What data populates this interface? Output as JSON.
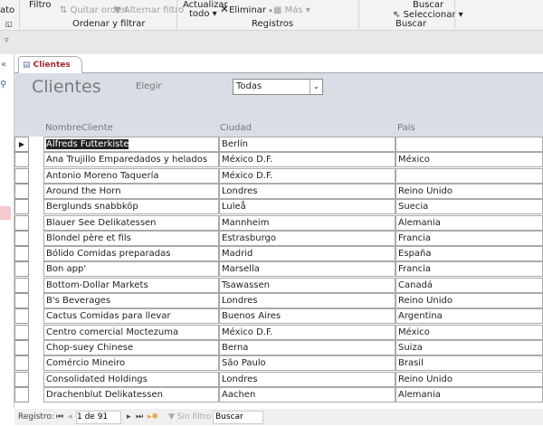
{
  "ribbon": {
    "filtro": "Filtro",
    "quitar_orden": "Quitar orden",
    "alternar_filtro": "Alternar filtro",
    "actualizar": "Actualizar",
    "todo": "todo ▾",
    "eliminar": "Eliminar",
    "mas": "Más ▾",
    "buscar_btn": "Buscar",
    "seleccionar": "Seleccionar ▾",
    "group_ordenar": "Ordenar y filtrar",
    "group_registros": "Registros",
    "group_buscar": "Buscar",
    "ato": "ato"
  },
  "tab": {
    "label": "Clientes"
  },
  "form": {
    "title": "Clientes",
    "elegir_label": "Elegir",
    "elegir_value": "Todas"
  },
  "columns": [
    "NombreCliente",
    "Ciudad",
    "Pais"
  ],
  "rows": [
    [
      "Alfreds Futterkiste",
      "Berlín",
      ""
    ],
    [
      "Ana Trujillo Emparedados y helados",
      "México D.F.",
      "México"
    ],
    [
      "Antonio Moreno Taquería",
      "México D.F.",
      ""
    ],
    [
      "Around the Horn",
      "Londres",
      "Reino Unido"
    ],
    [
      "Berglunds snabbköp",
      "Luleå",
      "Suecia"
    ],
    [
      "Blauer See Delikatessen",
      "Mannheim",
      "Alemania"
    ],
    [
      "Blondel père et fils",
      "Estrasburgo",
      "Francia"
    ],
    [
      "Bólido Comidas preparadas",
      "Madrid",
      "España"
    ],
    [
      "Bon app'",
      "Marsella",
      "Francia"
    ],
    [
      "Bottom-Dollar Markets",
      "Tsawassen",
      "Canadá"
    ],
    [
      "B's Beverages",
      "Londres",
      "Reino Unido"
    ],
    [
      "Cactus Comidas para llevar",
      "Buenos Aires",
      "Argentina"
    ],
    [
      "Centro comercial Moctezuma",
      "México D.F.",
      "México"
    ],
    [
      "Chop-suey Chinese",
      "Berna",
      "Suiza"
    ],
    [
      "Comércio Mineiro",
      "São Paulo",
      "Brasil"
    ],
    [
      "Consolidated Holdings",
      "Londres",
      "Reino Unido"
    ],
    [
      "Drachenblut Delikatessen",
      "Aachen",
      "Alemania"
    ]
  ],
  "status": {
    "registro": "Registro:",
    "position": "1 de 91",
    "sin_filtro": "Sin filtro",
    "buscar": "Buscar"
  }
}
